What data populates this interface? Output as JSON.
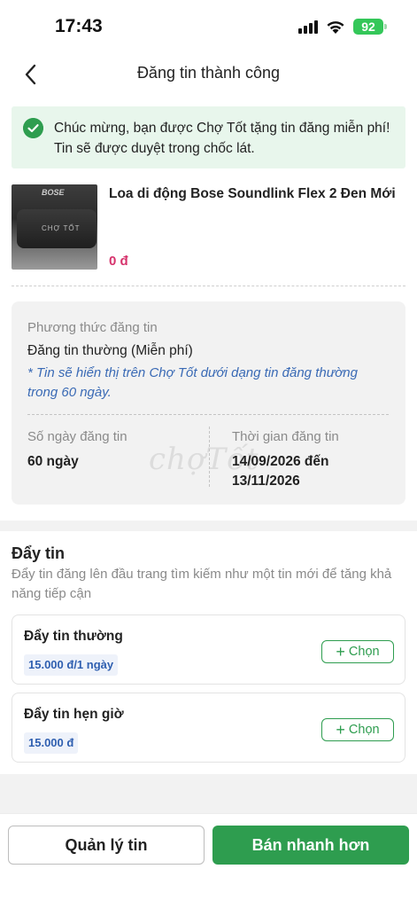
{
  "status_bar": {
    "time": "17:43",
    "battery": "92"
  },
  "header": {
    "title": "Đăng tin thành công",
    "back_icon": "chevron-left-icon"
  },
  "success_banner": {
    "icon": "check-circle-icon",
    "message": "Chúc mừng, bạn được Chợ Tốt tặng tin đăng miễn phí! Tin sẽ được duyệt trong chốc lát."
  },
  "listing": {
    "title": "Loa di động Bose Soundlink Flex 2 Đen Mới",
    "price": "0 đ",
    "thumb_brand": "BOSE",
    "thumb_label": "CHỢ TỐT"
  },
  "posting": {
    "method_label": "Phương thức đăng tin",
    "method_value": "Đăng tin thường (Miễn phí)",
    "method_note": "* Tin sẽ hiển thị trên Chợ Tốt dưới dạng tin đăng thường trong 60 ngày.",
    "days_label": "Số ngày đăng tin",
    "days_value": "60 ngày",
    "period_label": "Thời gian đăng tin",
    "period_value_line1": "14/09/2026 đến",
    "period_value_line2": "13/11/2026",
    "watermark": "chợTốt"
  },
  "push": {
    "title": "Đẩy tin",
    "description": "Đẩy tin đăng lên đầu trang tìm kiếm như một tin mới để tăng khả năng tiếp cận",
    "options": [
      {
        "name": "Đẩy tin thường",
        "price": "15.000 đ/1 ngày",
        "button": "Chọn"
      },
      {
        "name": "Đẩy tin hẹn giờ",
        "price": "15.000 đ",
        "button": "Chọn"
      }
    ]
  },
  "bottom": {
    "manage_label": "Quản lý tin",
    "sell_label": "Bán nhanh hơn"
  },
  "colors": {
    "accent_green": "#2e9d4f",
    "price_pink": "#d6336c",
    "note_blue": "#3a6ab5"
  }
}
